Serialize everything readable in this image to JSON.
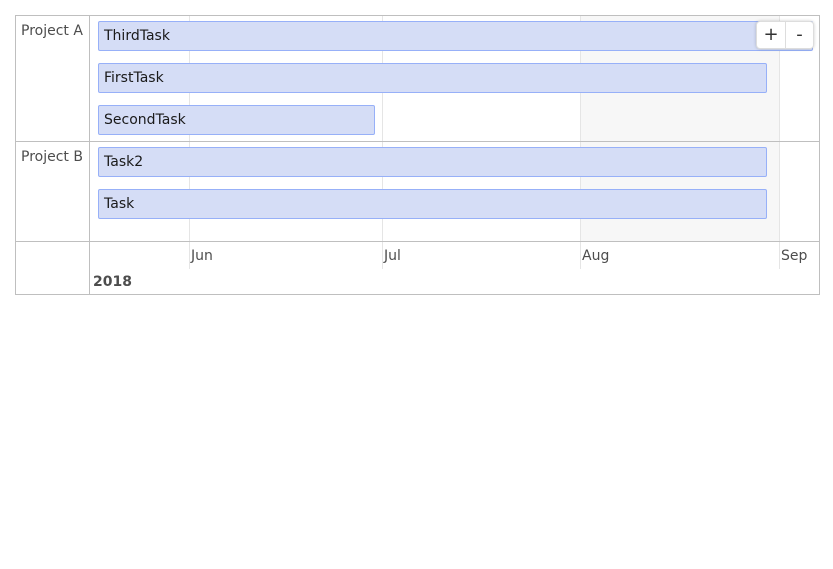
{
  "groups": [
    {
      "label": "Project A"
    },
    {
      "label": "Project B"
    }
  ],
  "items": [
    {
      "label": "ThirdTask"
    },
    {
      "label": "FirstTask"
    },
    {
      "label": "SecondTask"
    },
    {
      "label": "Task2"
    },
    {
      "label": "Task"
    }
  ],
  "axis": {
    "minor_labels": [
      "Jun",
      "Jul",
      "Aug",
      "Sep"
    ],
    "major_label": "2018"
  },
  "zoom": {
    "zoom_in_label": "+",
    "zoom_out_label": "-"
  },
  "colors": {
    "item_fill": "#d5ddf6",
    "item_border": "#97b0f8",
    "border": "#bfbfbf"
  }
}
